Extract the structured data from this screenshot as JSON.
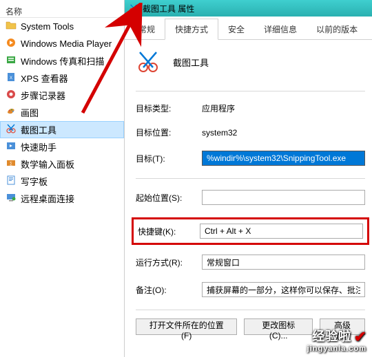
{
  "leftHeader": "名称",
  "items": [
    {
      "label": "System Tools",
      "icon": "folder"
    },
    {
      "label": "Windows Media Player",
      "icon": "wmp"
    },
    {
      "label": "Windows 传真和扫描",
      "icon": "fax"
    },
    {
      "label": "XPS 查看器",
      "icon": "xps"
    },
    {
      "label": "步骤记录器",
      "icon": "steps"
    },
    {
      "label": "画图",
      "icon": "paint"
    },
    {
      "label": "截图工具",
      "icon": "snip"
    },
    {
      "label": "快速助手",
      "icon": "quick"
    },
    {
      "label": "数学输入面板",
      "icon": "math"
    },
    {
      "label": "写字板",
      "icon": "wordpad"
    },
    {
      "label": "远程桌面连接",
      "icon": "rdp"
    }
  ],
  "selectedIndex": 6,
  "dialog": {
    "title": "截图工具 属性",
    "tabs": [
      "常规",
      "快捷方式",
      "安全",
      "详细信息",
      "以前的版本"
    ],
    "activeTab": 1,
    "appName": "截图工具",
    "fields": {
      "targetTypeLabel": "目标类型:",
      "targetTypeValue": "应用程序",
      "targetLocLabel": "目标位置:",
      "targetLocValue": "system32",
      "targetLabel": "目标(T):",
      "targetValue": "%windir%\\system32\\SnippingTool.exe",
      "startInLabel": "起始位置(S):",
      "startInValue": "",
      "shortcutLabel": "快捷键(K):",
      "shortcutValue": "Ctrl + Alt + X",
      "runLabel": "运行方式(R):",
      "runValue": "常规窗口",
      "commentLabel": "备注(O):",
      "commentValue": "捕获屏幕的一部分，这样你可以保存、批注或"
    },
    "buttons": {
      "openLoc": "打开文件所在的位置(F)",
      "changeIcon": "更改图标(C)...",
      "advanced": "高级(D)"
    }
  },
  "watermark": {
    "line1": "经验啦",
    "line2": "jingyanla.com"
  }
}
